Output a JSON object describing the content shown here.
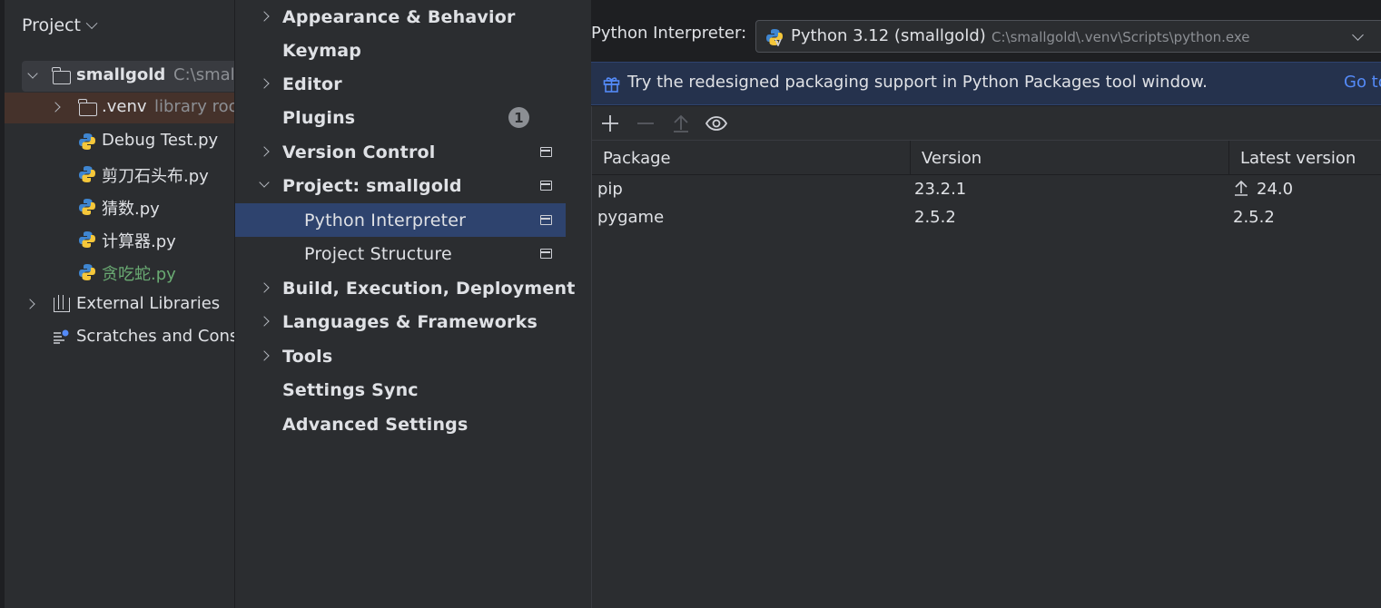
{
  "project_pane": {
    "title": "Project",
    "root": {
      "name": "smallgold",
      "path": "C:\\smallgold"
    },
    "items": [
      {
        "label": ".venv",
        "hint": "library root"
      },
      {
        "label": "Debug Test.py"
      },
      {
        "label": "剪刀石头布.py"
      },
      {
        "label": "猜数.py"
      },
      {
        "label": "计算器.py"
      },
      {
        "label": "贪吃蛇.py"
      },
      {
        "label": "External Libraries"
      },
      {
        "label": "Scratches and Consoles"
      }
    ]
  },
  "settings_nav": {
    "items": [
      {
        "label": "Appearance & Behavior"
      },
      {
        "label": "Keymap"
      },
      {
        "label": "Editor"
      },
      {
        "label": "Plugins",
        "badge": "1"
      },
      {
        "label": "Version Control"
      },
      {
        "label": "Project: smallgold"
      },
      {
        "label": "Python Interpreter"
      },
      {
        "label": "Project Structure"
      },
      {
        "label": "Build, Execution, Deployment"
      },
      {
        "label": "Languages & Frameworks"
      },
      {
        "label": "Tools"
      },
      {
        "label": "Settings Sync"
      },
      {
        "label": "Advanced Settings"
      }
    ]
  },
  "interpreter": {
    "label": "Python Interpreter:",
    "name": "Python 3.12 (smallgold)",
    "path": "C:\\smallgold\\.venv\\Scripts\\python.exe"
  },
  "banner": {
    "text": "Try the redesigned packaging support in Python Packages tool window.",
    "link": "Go to"
  },
  "packages": {
    "columns": [
      "Package",
      "Version",
      "Latest version"
    ],
    "rows": [
      {
        "package": "pip",
        "version": "23.2.1",
        "latest": "24.0",
        "upgrade": true
      },
      {
        "package": "pygame",
        "version": "2.5.2",
        "latest": "2.5.2",
        "upgrade": false
      }
    ]
  },
  "colors": {
    "selection": "#2e436e",
    "banner_bg": "#25324d",
    "link": "#548af7",
    "modified_file": "#6aab73"
  }
}
